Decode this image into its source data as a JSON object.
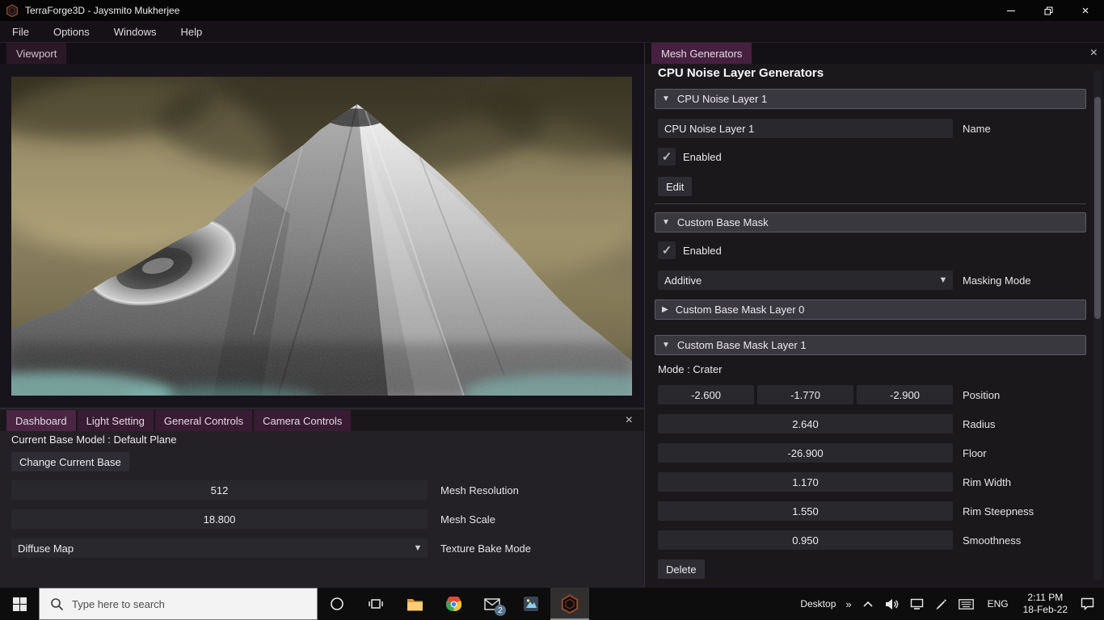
{
  "icons": {
    "collapse_open": "▼",
    "collapse_closed": "▶",
    "combo_arrow": "▼",
    "check": "✓",
    "close": "×",
    "more": "»"
  },
  "window": {
    "title": "TerraForge3D - Jaysmito Mukherjee"
  },
  "menu": {
    "items": [
      "File",
      "Options",
      "Windows",
      "Help"
    ]
  },
  "viewport": {
    "tab": "Viewport"
  },
  "dashboard": {
    "tabs": [
      "Dashboard",
      "Light Setting",
      "General Controls",
      "Camera Controls"
    ],
    "base_model_text": "Current Base Model : Default Plane",
    "change_base_button": "Change Current Base",
    "mesh_resolution": {
      "value": "512",
      "label": "Mesh Resolution"
    },
    "mesh_scale": {
      "value": "18.800",
      "label": "Mesh Scale"
    },
    "texture_bake": {
      "value": "Diffuse Map",
      "label": "Texture Bake Mode"
    }
  },
  "mesh_generators": {
    "tab": "Mesh Generators",
    "heading": "CPU Noise Layer Generators",
    "noise_layer": {
      "header": "CPU Noise Layer 1",
      "name_value": "CPU Noise Layer 1",
      "name_label": "Name",
      "enabled_label": "Enabled",
      "edit_button": "Edit"
    },
    "base_mask": {
      "header": "Custom Base Mask",
      "enabled_label": "Enabled",
      "masking_mode": {
        "value": "Additive",
        "label": "Masking Mode"
      },
      "layer0_header": "Custom Base Mask Layer 0",
      "layer1_header": "Custom Base Mask Layer 1",
      "mode_text": "Mode : Crater",
      "position": {
        "values": [
          "-2.600",
          "-1.770",
          "-2.900"
        ],
        "label": "Position"
      },
      "params": [
        {
          "value": "2.640",
          "label": "Radius"
        },
        {
          "value": "-26.900",
          "label": "Floor"
        },
        {
          "value": "1.170",
          "label": "Rim Width"
        },
        {
          "value": "1.550",
          "label": "Rim Steepness"
        },
        {
          "value": "0.950",
          "label": "Smoothness"
        }
      ],
      "delete_button": "Delete"
    }
  },
  "taskbar": {
    "search_placeholder": "Type here to search",
    "mail_badge": "2",
    "desktop_label": "Desktop",
    "language": "ENG",
    "time": "2:11 PM",
    "date": "18-Feb-22"
  }
}
